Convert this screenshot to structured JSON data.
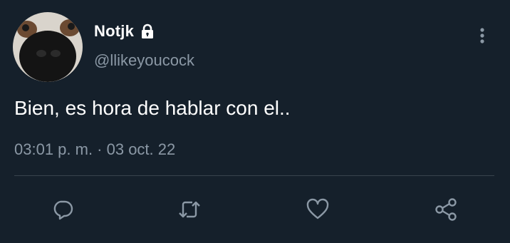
{
  "user": {
    "display_name": "Notjk",
    "handle": "@llikeyoucock"
  },
  "icons": {
    "protected": "lock-icon",
    "more": "more-vertical-icon",
    "reply": "reply-icon",
    "retweet": "retweet-icon",
    "like": "heart-icon",
    "share": "share-icon"
  },
  "tweet": {
    "text": "Bien, es hora de hablar con el..",
    "timestamp": "03:01 p. m. · 03 oct. 22"
  },
  "colors": {
    "background": "#15202b",
    "secondary_text": "#8b98a5",
    "divider": "#38444d"
  }
}
